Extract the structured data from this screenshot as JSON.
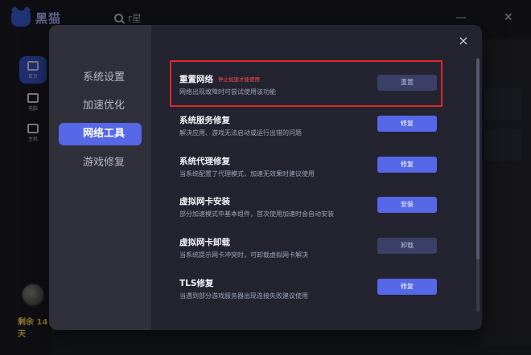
{
  "app": {
    "logo_text": "黑猫",
    "search_text": "r星",
    "sidebar": [
      {
        "label": "首页"
      },
      {
        "label": "电脑"
      },
      {
        "label": "主机"
      }
    ],
    "remaining_text": "剩余 14天"
  },
  "dialog": {
    "close_label": "×",
    "menu": [
      {
        "label": "系统设置"
      },
      {
        "label": "加速优化"
      },
      {
        "label": "网络工具"
      },
      {
        "label": "游戏修复"
      }
    ],
    "tools": [
      {
        "title": "重置网络",
        "warning": "停止加速才能使用",
        "desc": "网络出现故障时可尝试使用该功能",
        "button": "重置",
        "enabled": false
      },
      {
        "title": "系统服务修复",
        "desc": "解决应用、游戏无法启动或运行出错的问题",
        "button": "修复",
        "enabled": true
      },
      {
        "title": "系统代理修复",
        "desc": "当系统配置了代理模式，加速无效果时建议使用",
        "button": "修复",
        "enabled": true
      },
      {
        "title": "虚拟网卡安装",
        "desc": "部分加速模式中基本组件，首次使用加速时会自动安装",
        "button": "安装",
        "enabled": true
      },
      {
        "title": "虚拟网卡卸载",
        "desc": "当系统提示网卡冲突时，可卸载虚拟网卡解决",
        "button": "卸载",
        "enabled": false
      },
      {
        "title": "TLS修复",
        "desc": "当遇到部分游戏服务器出现连接失败建议使用",
        "button": "修复",
        "enabled": true
      }
    ]
  },
  "colors": {
    "accent": "#5667e8",
    "highlight_border": "#e0242a",
    "warning_text": "#ff4a4a"
  }
}
